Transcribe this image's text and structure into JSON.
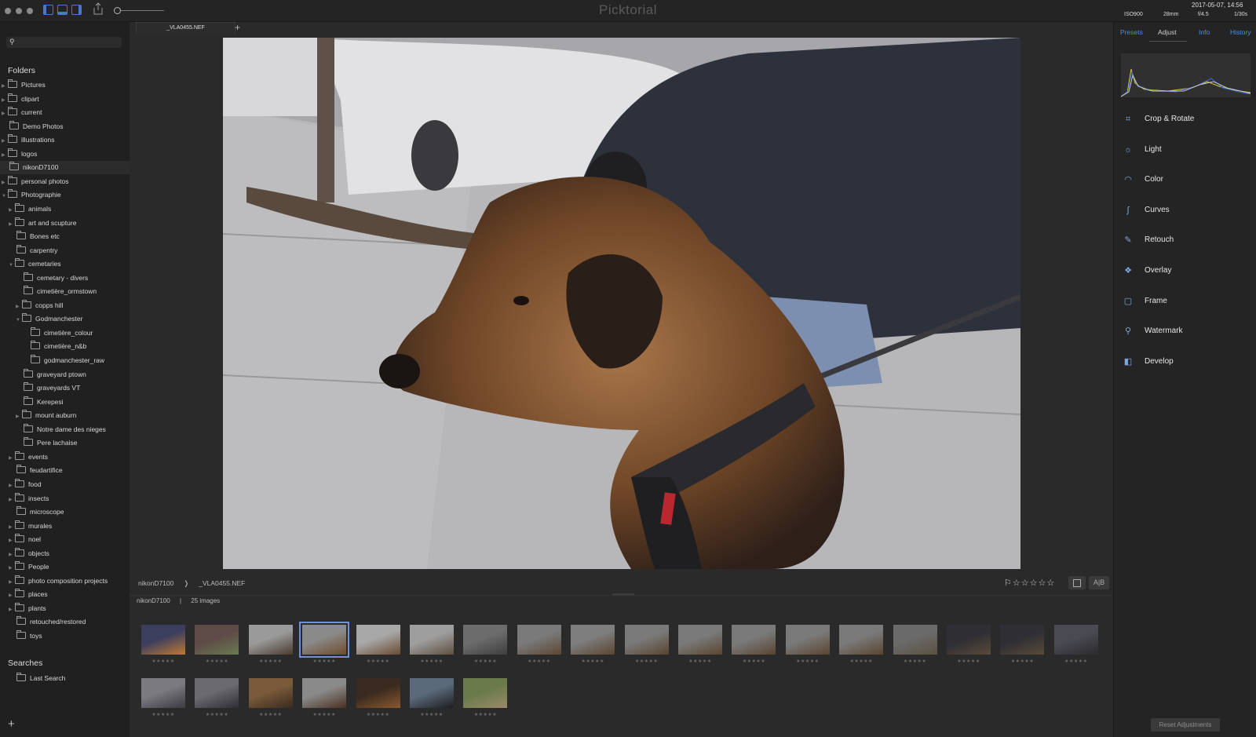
{
  "app": {
    "title": "Picktorial"
  },
  "exif": {
    "iso": "ISO900",
    "focal": "28mm",
    "aperture": "f/4.5",
    "shutter": "1/30s",
    "datetime": "2017-05-07, 14:56"
  },
  "tab": {
    "label": "_VLA0455.NEF",
    "add": "+"
  },
  "sidebar": {
    "folders_title": "Folders",
    "searches_title": "Searches",
    "add": "+",
    "folders": [
      {
        "label": "Pictures",
        "depth": 0,
        "expand": "right"
      },
      {
        "label": "clipart",
        "depth": 0,
        "expand": "right"
      },
      {
        "label": "current",
        "depth": 0,
        "expand": "right"
      },
      {
        "label": "Demo Photos",
        "depth": 0,
        "expand": "none"
      },
      {
        "label": "illustrations",
        "depth": 0,
        "expand": "right"
      },
      {
        "label": "logos",
        "depth": 0,
        "expand": "right"
      },
      {
        "label": "nikonD7100",
        "depth": 0,
        "expand": "none",
        "selected": true
      },
      {
        "label": "personal photos",
        "depth": 0,
        "expand": "right"
      },
      {
        "label": "Photographie",
        "depth": 0,
        "expand": "down"
      },
      {
        "label": "animals",
        "depth": 1,
        "expand": "right"
      },
      {
        "label": "art and scupture",
        "depth": 1,
        "expand": "right"
      },
      {
        "label": "Bones etc",
        "depth": 1,
        "expand": "none"
      },
      {
        "label": "carpentry",
        "depth": 1,
        "expand": "none"
      },
      {
        "label": "cemetaries",
        "depth": 1,
        "expand": "down"
      },
      {
        "label": "cemetary - divers",
        "depth": 2,
        "expand": "none"
      },
      {
        "label": "cimetière_ormstown",
        "depth": 2,
        "expand": "none"
      },
      {
        "label": "copps hill",
        "depth": 2,
        "expand": "right"
      },
      {
        "label": "Godmanchester",
        "depth": 2,
        "expand": "down"
      },
      {
        "label": "cimetière_colour",
        "depth": 3,
        "expand": "none"
      },
      {
        "label": "cimetière_n&b",
        "depth": 3,
        "expand": "none"
      },
      {
        "label": "godmanchester_raw",
        "depth": 3,
        "expand": "none"
      },
      {
        "label": "graveyard ptown",
        "depth": 2,
        "expand": "none"
      },
      {
        "label": "graveyards VT",
        "depth": 2,
        "expand": "none"
      },
      {
        "label": "Kerepesi",
        "depth": 2,
        "expand": "none"
      },
      {
        "label": "mount auburn",
        "depth": 2,
        "expand": "right"
      },
      {
        "label": "Notre dame des nieges",
        "depth": 2,
        "expand": "none"
      },
      {
        "label": "Pere lachaise",
        "depth": 2,
        "expand": "none"
      },
      {
        "label": "events",
        "depth": 1,
        "expand": "right"
      },
      {
        "label": "feudartifice",
        "depth": 1,
        "expand": "none"
      },
      {
        "label": "food",
        "depth": 1,
        "expand": "right"
      },
      {
        "label": "insects",
        "depth": 1,
        "expand": "right"
      },
      {
        "label": "microscope",
        "depth": 1,
        "expand": "none"
      },
      {
        "label": "murales",
        "depth": 1,
        "expand": "right"
      },
      {
        "label": "noel",
        "depth": 1,
        "expand": "right"
      },
      {
        "label": "objects",
        "depth": 1,
        "expand": "right"
      },
      {
        "label": "People",
        "depth": 1,
        "expand": "right"
      },
      {
        "label": "photo composition projects",
        "depth": 1,
        "expand": "right"
      },
      {
        "label": "places",
        "depth": 1,
        "expand": "right"
      },
      {
        "label": "plants",
        "depth": 1,
        "expand": "right"
      },
      {
        "label": "retouched/restored",
        "depth": 1,
        "expand": "none"
      },
      {
        "label": "toys",
        "depth": 1,
        "expand": "none"
      }
    ],
    "searches": [
      {
        "label": "Last Search"
      }
    ]
  },
  "breadcrumb": {
    "folder": "nikonD7100",
    "sep": "❭",
    "file": "_VLA0455.NEF"
  },
  "grid_info": {
    "folder": "nikonD7100",
    "sep": "|",
    "count": "25 images"
  },
  "rating": {
    "flag": "⚐",
    "stars": "☆☆☆☆☆"
  },
  "view_buttons": {
    "ab": "A|B"
  },
  "right_panel": {
    "tabs": [
      "Presets",
      "Adjust",
      "Info",
      "History"
    ],
    "active_tab": "Adjust",
    "tools": [
      {
        "label": "Crop & Rotate",
        "icon": "crop-icon",
        "glyph": "⌗"
      },
      {
        "label": "Light",
        "icon": "bulb-icon",
        "glyph": "☼"
      },
      {
        "label": "Color",
        "icon": "rainbow-icon",
        "glyph": "◠"
      },
      {
        "label": "Curves",
        "icon": "curve-icon",
        "glyph": "∫"
      },
      {
        "label": "Retouch",
        "icon": "brush-icon",
        "glyph": "✎"
      },
      {
        "label": "Overlay",
        "icon": "overlay-icon",
        "glyph": "❖"
      },
      {
        "label": "Frame",
        "icon": "frame-icon",
        "glyph": "▢"
      },
      {
        "label": "Watermark",
        "icon": "watermark-icon",
        "glyph": "⚲"
      },
      {
        "label": "Develop",
        "icon": "develop-icon",
        "glyph": "◧"
      }
    ],
    "reset": "Reset Adjustments"
  },
  "thumbnails": {
    "star_text": "★★★★★",
    "selected_index": 3,
    "items": [
      {
        "c1": "#3c3e5e",
        "c2": "#c07a32"
      },
      {
        "c1": "#5e4a46",
        "c2": "#6a7a52"
      },
      {
        "c1": "#9a9a9a",
        "c2": "#4a3a2e"
      },
      {
        "c1": "#8a8a8a",
        "c2": "#6e4a2a"
      },
      {
        "c1": "#a8a8a8",
        "c2": "#6a4a30"
      },
      {
        "c1": "#9e9e9e",
        "c2": "#5e4e40"
      },
      {
        "c1": "#6c6c6c",
        "c2": "#3e3e3e"
      },
      {
        "c1": "#7a7a7a",
        "c2": "#5e4632"
      },
      {
        "c1": "#7e7e7e",
        "c2": "#5a4430"
      },
      {
        "c1": "#7a7a7a",
        "c2": "#5a4430"
      },
      {
        "c1": "#7a7a7a",
        "c2": "#5a4430"
      },
      {
        "c1": "#7a7a7a",
        "c2": "#5a4430"
      },
      {
        "c1": "#7a7a7a",
        "c2": "#5a4430"
      },
      {
        "c1": "#7a7a7a",
        "c2": "#5a4430"
      },
      {
        "c1": "#6a6a6a",
        "c2": "#5a5240"
      },
      {
        "c1": "#2e2e34",
        "c2": "#5a4a3a"
      },
      {
        "c1": "#2e2e34",
        "c2": "#5a4a3a"
      },
      {
        "c1": "#4a4a52",
        "c2": "#2a2a2e"
      },
      {
        "c1": "#7a7a80",
        "c2": "#3a3a40"
      },
      {
        "c1": "#6a6a70",
        "c2": "#2e2e34"
      },
      {
        "c1": "#7a5a3a",
        "c2": "#3a2a1e"
      },
      {
        "c1": "#8a8a8a",
        "c2": "#4a3020"
      },
      {
        "c1": "#3a2a20",
        "c2": "#8a5a2e"
      },
      {
        "c1": "#5a6a7a",
        "c2": "#1e1e22"
      },
      {
        "c1": "#6a7a4a",
        "c2": "#9a8a6a"
      }
    ]
  }
}
